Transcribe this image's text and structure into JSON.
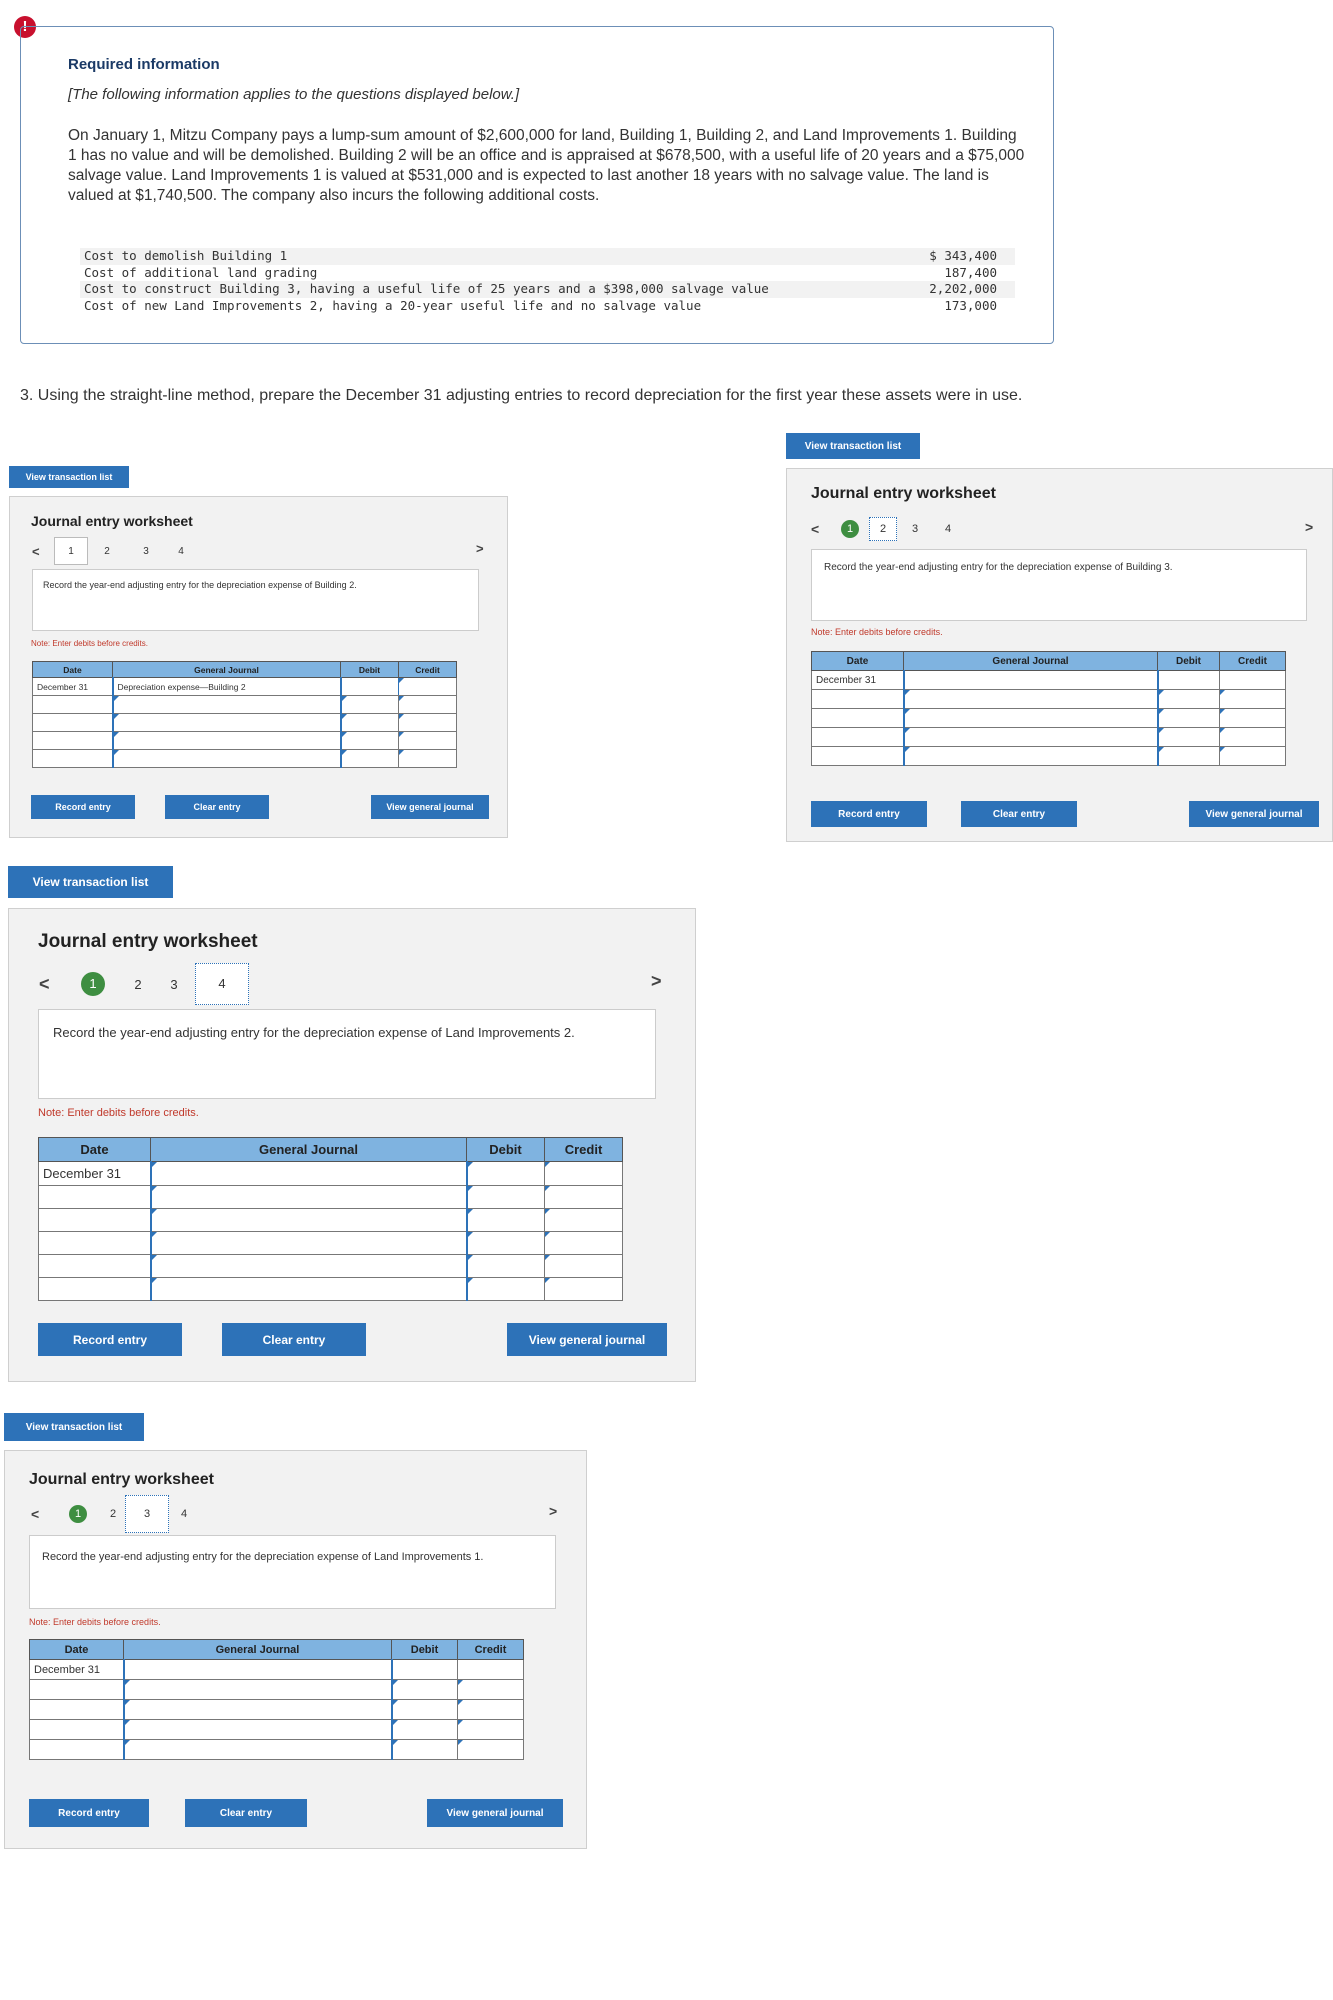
{
  "info": {
    "alert_icon": "!",
    "title": "Required information",
    "subtitle": "[The following information applies to the questions displayed below.]",
    "paragraph": "On January 1, Mitzu Company pays a lump-sum amount of $2,600,000 for land, Building 1, Building 2, and Land Improvements 1. Building 1 has no value and will be demolished. Building 2 will be an office and is appraised at $678,500, with a useful life of 20 years and a $75,000 salvage value. Land Improvements 1 is valued at $531,000 and is expected to last another 18 years with no salvage value. The land is valued at $1,740,500. The company also incurs the following additional costs.",
    "costs": [
      {
        "label": "Cost to demolish Building 1",
        "amount": "$ 343,400"
      },
      {
        "label": "Cost of additional land grading",
        "amount": "187,400"
      },
      {
        "label": "Cost to construct Building 3, having a useful life of 25 years and a $398,000 salvage value",
        "amount": "2,202,000"
      },
      {
        "label": "Cost of new Land Improvements 2, having a 20-year useful life and no salvage value",
        "amount": "173,000"
      }
    ]
  },
  "question": "3. Using the straight-line method, prepare the December 31 adjusting entries to record depreciation for the first year these assets were in use.",
  "labels": {
    "view_transaction_list": "View transaction list",
    "worksheet_title": "Journal entry worksheet",
    "note": "Note: Enter debits before credits.",
    "col_date": "Date",
    "col_journal": "General Journal",
    "col_debit": "Debit",
    "col_credit": "Credit",
    "record_entry": "Record entry",
    "clear_entry": "Clear entry",
    "view_general_journal": "View general journal",
    "nav_prev": "<",
    "nav_next": ">"
  },
  "worksheets": [
    {
      "nav": [
        "1",
        "2",
        "3",
        "4"
      ],
      "prompt": "Record the year-end adjusting entry for the depreciation expense of Building 2.",
      "date": "December 31",
      "account": "Depreciation expense—Building 2"
    },
    {
      "nav": [
        "1",
        "2",
        "3",
        "4"
      ],
      "prompt": "Record the year-end adjusting entry for the depreciation expense of Building 3.",
      "date": "December 31",
      "account": ""
    },
    {
      "nav": [
        "1",
        "2",
        "3",
        "4"
      ],
      "prompt": "Record the year-end adjusting entry for the depreciation expense of Land Improvements 2.",
      "date": "December 31",
      "account": ""
    },
    {
      "nav": [
        "1",
        "2",
        "3",
        "4"
      ],
      "prompt": "Record the year-end adjusting entry for the depreciation expense of Land Improvements 1.",
      "date": "December 31",
      "account": ""
    }
  ],
  "colors": {
    "button": "#2d72b8",
    "table_header": "#7fb3e0",
    "completed_step": "#3e8e41",
    "note": "#c0392b",
    "alert": "#c8102e"
  }
}
